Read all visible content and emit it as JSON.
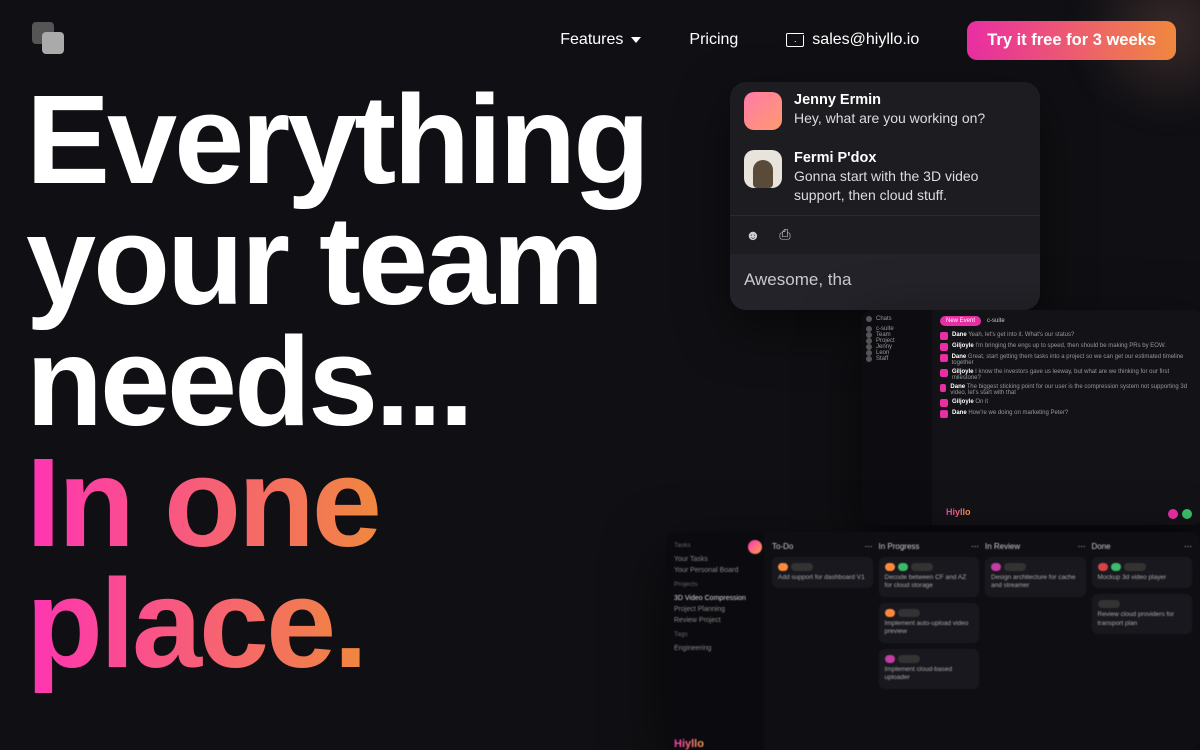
{
  "nav": {
    "features": "Features",
    "pricing": "Pricing",
    "email": "sales@hiyllo.io",
    "cta": "Try it free for 3 weeks"
  },
  "hero": {
    "line1": "Everything",
    "line2": "your team",
    "line3": "needs...",
    "line4a": "In one",
    "line4b": "place."
  },
  "chat": {
    "msg1_name": "Jenny Ermin",
    "msg1_text": "Hey, what are you working on?",
    "msg2_name": "Fermi P'dox",
    "msg2_text": "Gonna start with the 3D video support, then cloud stuff.",
    "input": "Awesome, tha"
  },
  "proj": {
    "new_event": "New Event",
    "channel": "c-suite",
    "side_items": [
      "c-suite",
      "Team",
      "Project",
      "Jenny",
      "Leon",
      "Staff"
    ],
    "log": [
      {
        "name": "Dane",
        "text": "Yeah, let's get into it. What's our status?"
      },
      {
        "name": "Giljoyle",
        "text": "I'm bringing the engs up to speed, then should be making PRs by EOW."
      },
      {
        "name": "Dane",
        "text": "Great, start getting them tasks into a project so we can get our estimated timeline together"
      },
      {
        "name": "Giljoyle",
        "text": "I know the investors gave us leeway, but what are we thinking for our first milestone?"
      },
      {
        "name": "Dane",
        "text": "The biggest sticking point for our user is the compression system not supporting 3d video, let's start with that"
      },
      {
        "name": "Giljoyle",
        "text": "On it"
      },
      {
        "name": "Dane",
        "text": "How're we doing on marketing Peter?"
      }
    ],
    "brand": "Hiyllo"
  },
  "kanban": {
    "side_header1": "Tasks",
    "side_items1": [
      "Your Tasks",
      "Your Personal Board"
    ],
    "side_header2": "Projects",
    "side_items2": [
      "3D Video Compression",
      "Project Planning",
      "Review Project"
    ],
    "side_header3": "Tags",
    "side_items3": [
      "Engineering"
    ],
    "cols": [
      {
        "title": "To-Do",
        "cards": [
          {
            "chips": [
              "o",
              "gray"
            ],
            "t": "Add support for dashboard V1"
          }
        ]
      },
      {
        "title": "In Progress",
        "cards": [
          {
            "chips": [
              "o",
              "g",
              "gray"
            ],
            "t": "Decode between CF and AZ for cloud storage"
          },
          {
            "chips": [
              "o",
              "gray"
            ],
            "t": "Implement auto-upload video preview"
          },
          {
            "chips": [
              "p",
              "gray"
            ],
            "t": "Implement cloud-based uploader"
          }
        ]
      },
      {
        "title": "In Review",
        "cards": [
          {
            "chips": [
              "p",
              "gray"
            ],
            "t": "Design architecture for cache and streamer"
          }
        ]
      },
      {
        "title": "Done",
        "cards": [
          {
            "chips": [
              "r",
              "g",
              "gray"
            ],
            "t": "Mockup 3d video player"
          },
          {
            "chips": [
              "gray"
            ],
            "t": "Review cloud providers for transport plan"
          }
        ]
      }
    ],
    "brand": "Hiyllo"
  }
}
